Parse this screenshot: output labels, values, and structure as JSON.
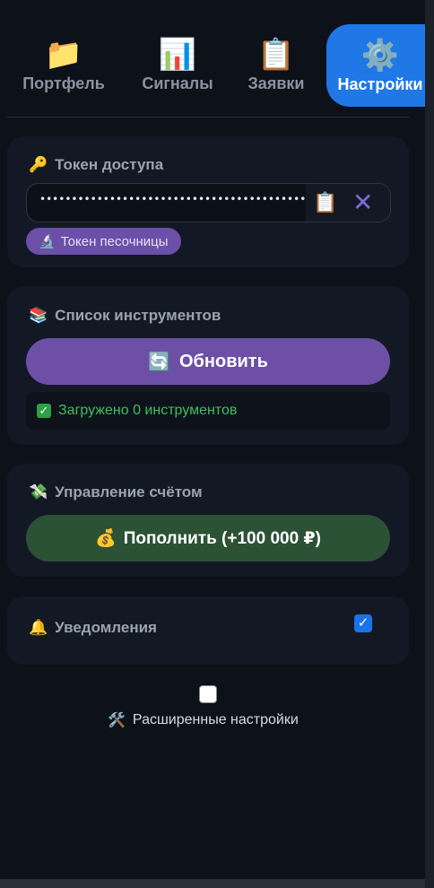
{
  "tabs": [
    {
      "icon": "📁",
      "label": "Портфель"
    },
    {
      "icon": "📊",
      "label": "Сигналы"
    },
    {
      "icon": "📋",
      "label": "Заявки"
    },
    {
      "icon": "⚙️",
      "label": "Настройки"
    }
  ],
  "token": {
    "title_icon": "🔑",
    "title": "Токен доступа",
    "value": "••••••••••••••••••••••••••••••••••••••••••••••••••••••••••••",
    "paste_icon": "📋",
    "clear_icon": "✕",
    "sandbox_icon": "🔬",
    "sandbox_label": "Токен песочницы"
  },
  "instruments": {
    "title_icon": "📚",
    "title": "Список инструментов",
    "refresh_icon": "🔄",
    "refresh_label": "Обновить",
    "status_icon": "✓",
    "status": "Загружено 0 инструментов"
  },
  "account": {
    "title_icon": "💸",
    "title": "Управление счётом",
    "topup_icon": "💰",
    "topup_label": "Пополнить (+100 000 ₽)"
  },
  "notifications": {
    "title_icon": "🔔",
    "title": "Уведомления",
    "checked": true,
    "check_glyph": "✓"
  },
  "advanced": {
    "icon": "🛠️",
    "label": "Расширенные настройки",
    "checked": false
  },
  "colors": {
    "accent": "#1f78e6",
    "refresh": "#6d4fa6",
    "topup": "#2c5236",
    "status_ok": "#3fbf5f"
  }
}
